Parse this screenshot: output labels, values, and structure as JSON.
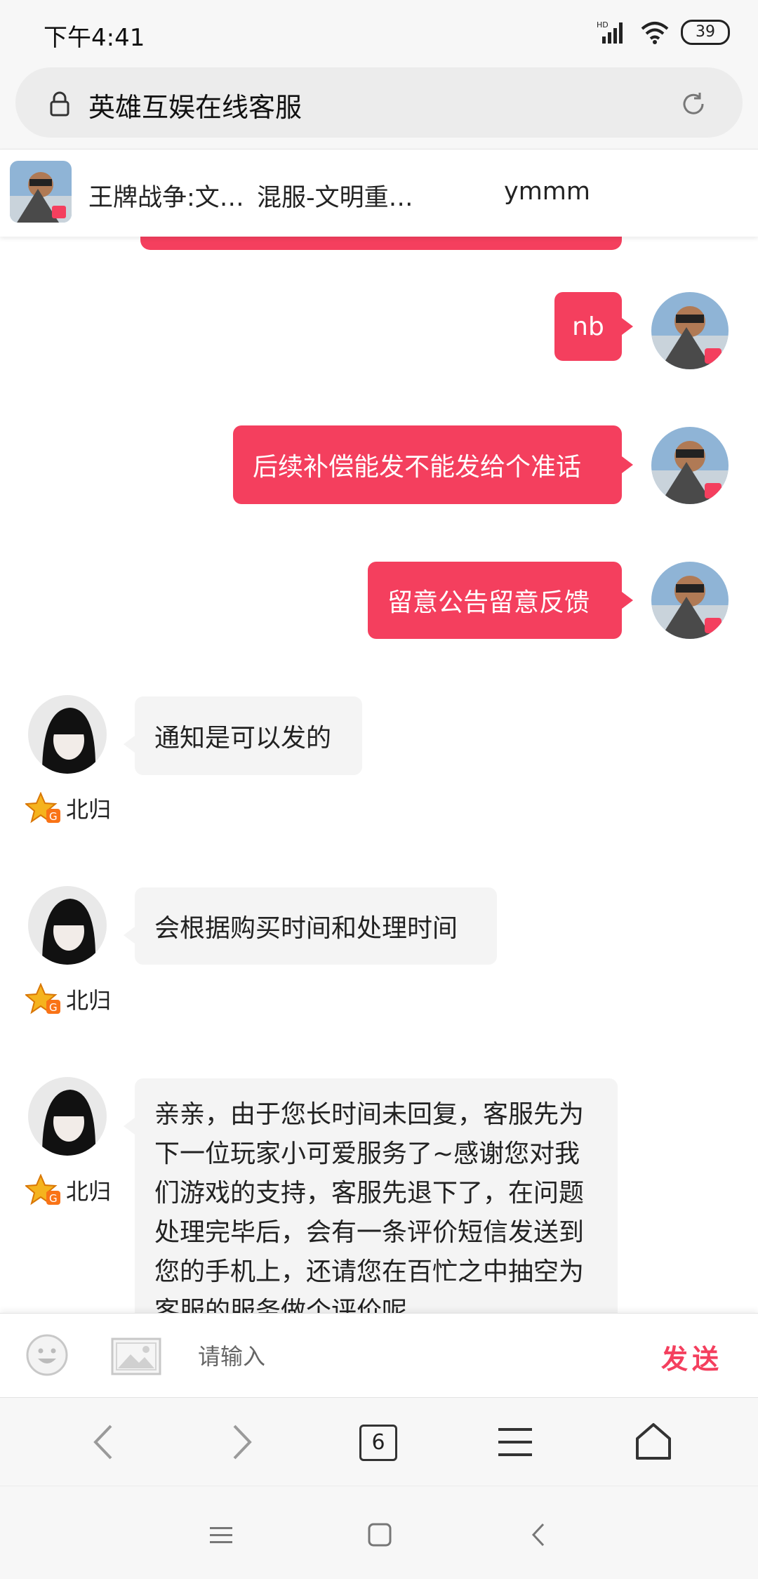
{
  "status_bar": {
    "time": "下午4:41",
    "battery": "39",
    "network": "HD"
  },
  "url_bar": {
    "title": "英雄互娱在线客服"
  },
  "chat_header": {
    "game": "王牌战争:文…",
    "server": "混服-文明重…",
    "player": "ymmm"
  },
  "messages": [
    {
      "side": "out",
      "text": "nb"
    },
    {
      "side": "out",
      "text": "后续补偿能发不能发给个准话"
    },
    {
      "side": "out",
      "text": "留意公告留意反馈"
    },
    {
      "side": "in",
      "text": "通知是可以发的",
      "sender": "北归"
    },
    {
      "side": "in",
      "text": "会根据购买时间和处理时间",
      "sender": "北归"
    },
    {
      "side": "in",
      "text": "亲亲，由于您长时间未回复，客服先为下一位玩家小可爱服务了~感谢您对我们游戏的支持，客服先退下了，在问题处理完毕后，会有一条评价短信发送到您的手机上，还请您在百忙之中抽空为客服的服务做个评价呢",
      "sender": "北归"
    }
  ],
  "input_bar": {
    "placeholder": "请输入",
    "send_label": "发送"
  },
  "toolbar": {
    "tab_count": "6"
  },
  "colors": {
    "accent": "#f43f5e",
    "incoming_bubble": "#f4f4f4"
  },
  "icons": [
    "lock-icon",
    "reload-icon",
    "emoji-icon",
    "image-icon",
    "back-arrow-icon",
    "forward-arrow-icon",
    "menu-icon",
    "home-icon"
  ]
}
